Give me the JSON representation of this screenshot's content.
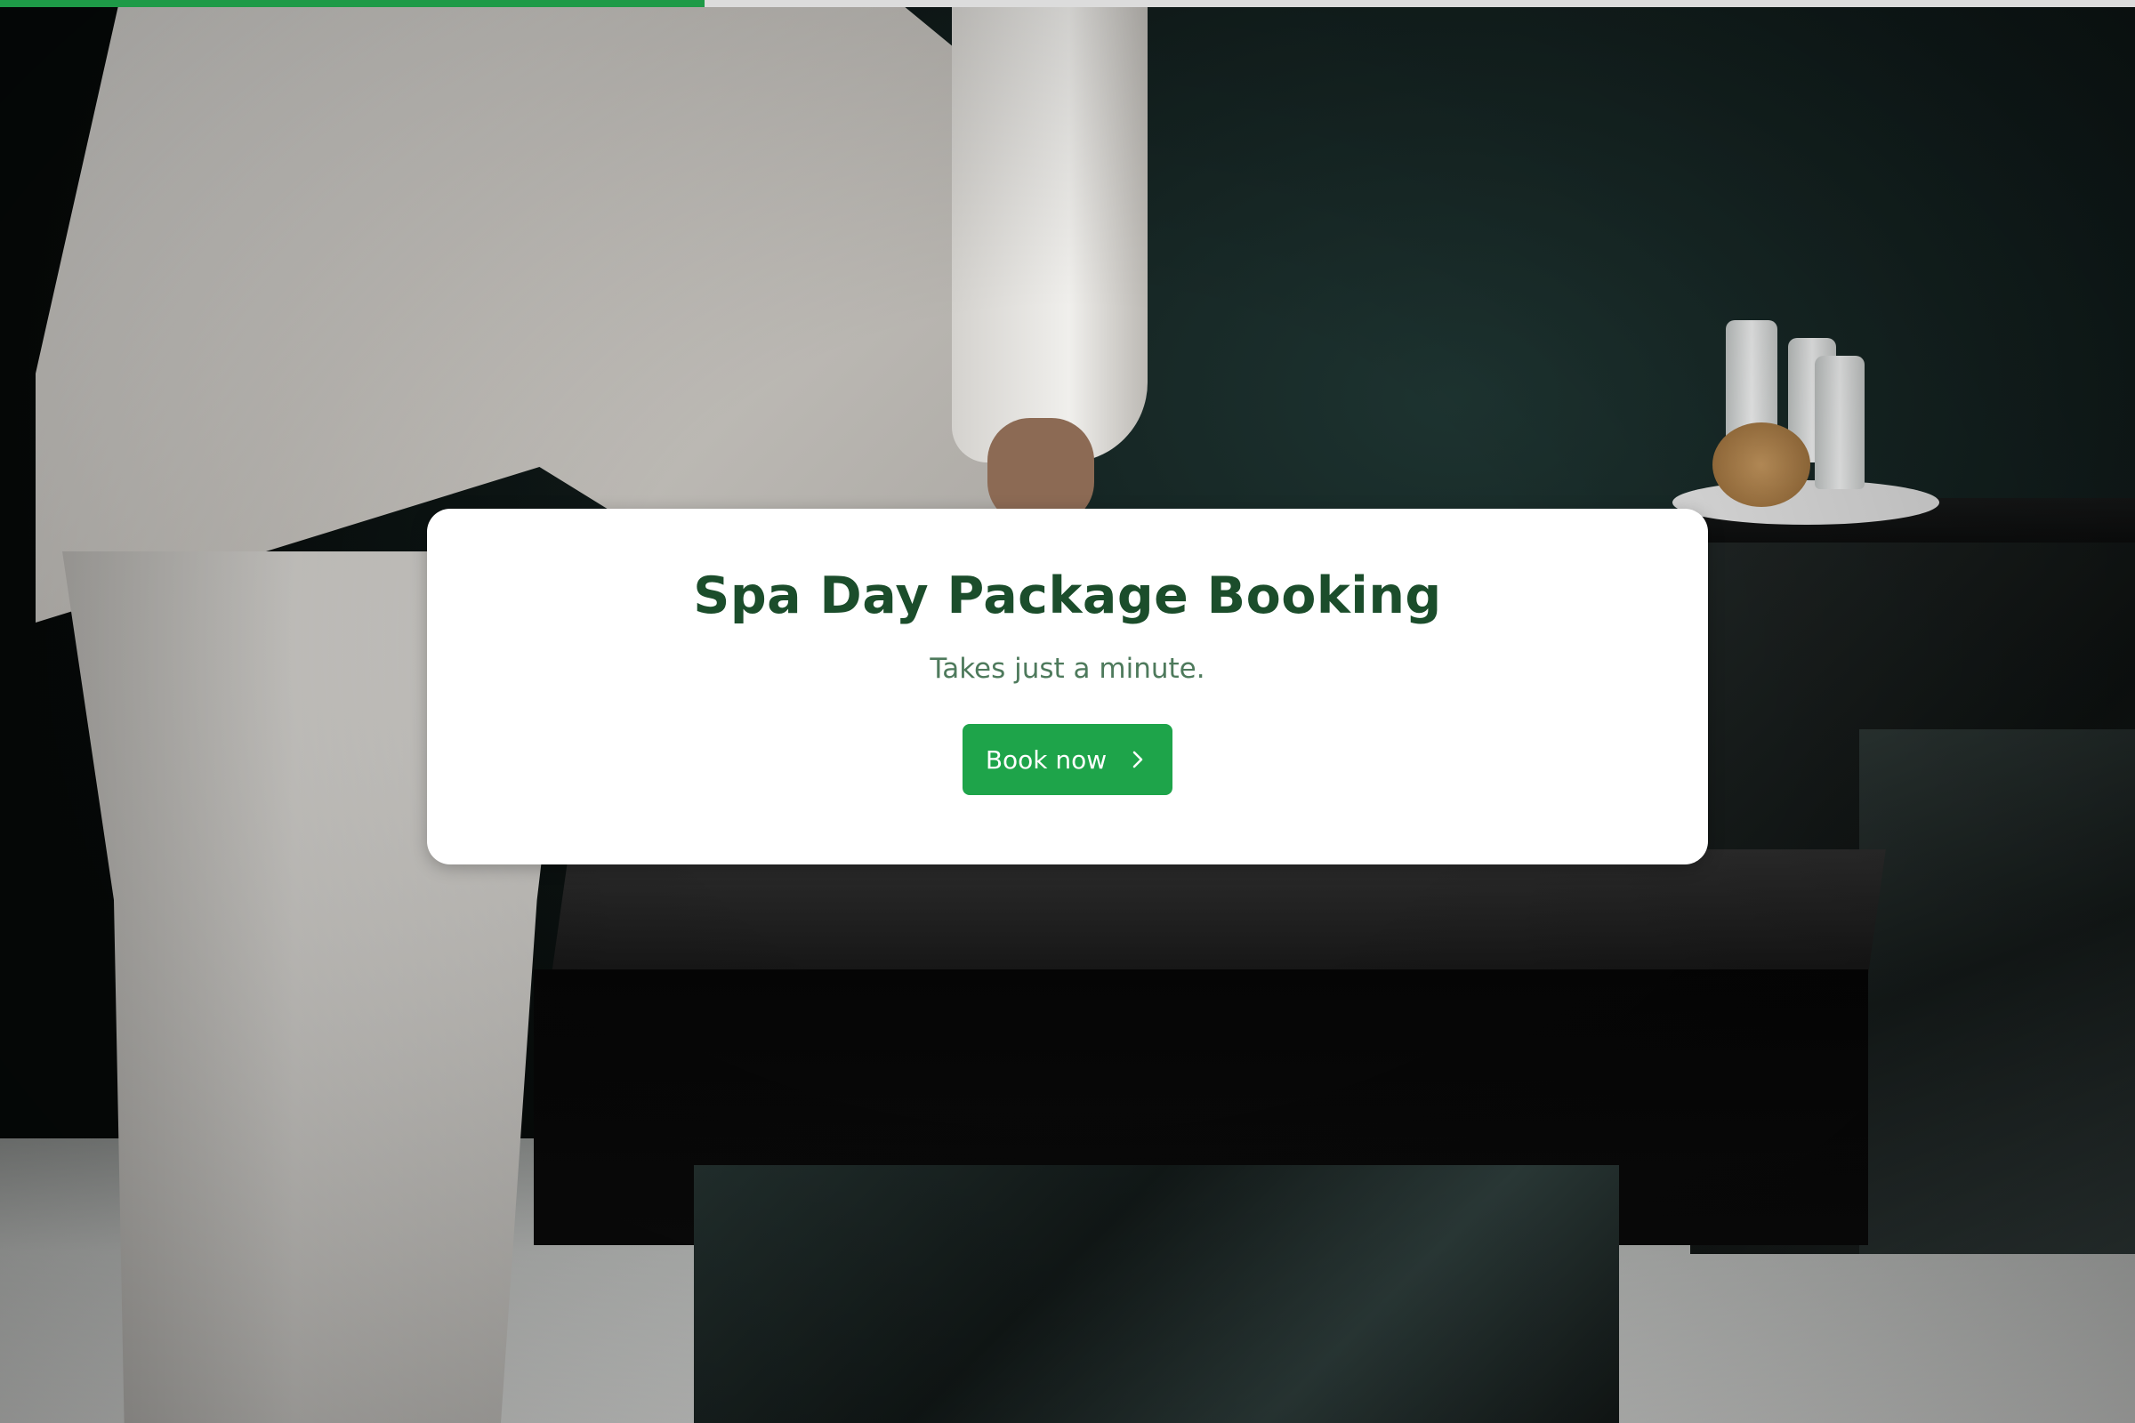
{
  "progress": {
    "fraction": 0.33,
    "fill_color": "#1e9a47",
    "track_color": "#dcdcdc"
  },
  "background": {
    "image_description_icon": "spa-photo"
  },
  "card": {
    "title": "Spa Day Package Booking",
    "subtitle": "Takes just a minute.",
    "button_label": "Book now",
    "button_icon": "chevron-right-icon",
    "title_color": "#1b4d2b",
    "subtitle_color": "#4e7a5c",
    "button_color": "#1ea44a"
  }
}
